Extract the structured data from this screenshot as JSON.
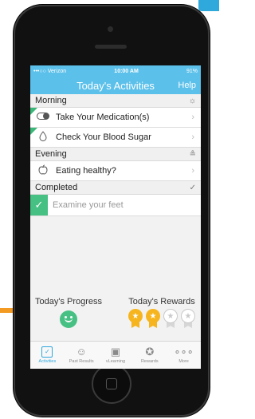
{
  "status_bar": {
    "carrier": "•••○○ Verizon",
    "time": "10:00 AM",
    "battery": "91%"
  },
  "header": {
    "title": "Today's Activities",
    "help": "Help"
  },
  "sections": {
    "morning": "Morning",
    "evening": "Evening",
    "completed": "Completed"
  },
  "activities": {
    "medication": "Take Your Medication(s)",
    "blood_sugar": "Check Your Blood Sugar",
    "eating": "Eating healthy?",
    "feet": "Examine your feet"
  },
  "summary": {
    "progress": "Today's Progress",
    "rewards": "Today's Rewards"
  },
  "rewards": {
    "gold": 2,
    "gray": 2
  },
  "tabs": [
    "Activities",
    "Past Results",
    "vLearning",
    "Rewards",
    "More"
  ],
  "colors": {
    "accent": "#5bc0ea",
    "complete": "#46c083",
    "gold": "#f6b51e"
  },
  "icons": {
    "morning": "sunrise-icon",
    "evening": "sunset-icon",
    "completed": "checkmark-icon",
    "medication": "pill-icon",
    "blood_sugar": "drop-icon",
    "eating": "apple-icon"
  }
}
